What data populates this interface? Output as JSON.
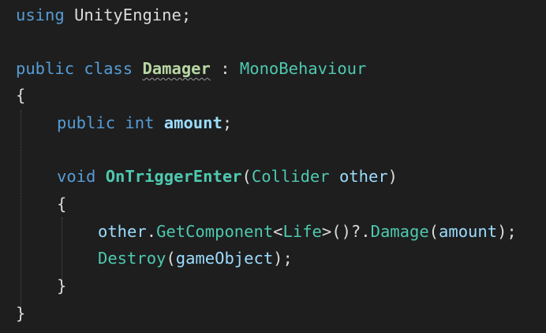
{
  "editor": {
    "colors": {
      "background": "#1e1e1e",
      "keyword": "#569cd6",
      "type": "#4ec9b0",
      "method": "#4ec9b0",
      "identifier": "#9cdcfe",
      "text": "#dcdcdc",
      "classname": "#b8d7a3"
    },
    "lines": {
      "l1": {
        "kw": "using",
        "ns": "UnityEngine",
        "end": ";"
      },
      "l3": {
        "kw1": "public",
        "kw2": "class",
        "name": "Damager",
        "colon": ":",
        "base": "MonoBehaviour"
      },
      "l4": {
        "brace": "{"
      },
      "l5": {
        "kw1": "public",
        "kw2": "int",
        "field": "amount",
        "end": ";"
      },
      "l7": {
        "kw": "void",
        "method": "OnTriggerEnter",
        "open": "(",
        "ptype": "Collider",
        "pname": "other",
        "close": ")"
      },
      "l8": {
        "brace": "{"
      },
      "l9": {
        "obj": "other",
        "dot1": ".",
        "m1": "GetComponent",
        "lt": "<",
        "gtype": "Life",
        "gt": ">",
        "call": "()?",
        "dot2": ".",
        "m2": "Damage",
        "open": "(",
        "arg": "amount",
        "close": ");"
      },
      "l10": {
        "m": "Destroy",
        "open": "(",
        "arg": "gameObject",
        "close": ");"
      },
      "l11": {
        "brace": "}"
      },
      "l12": {
        "brace": "}"
      }
    }
  }
}
